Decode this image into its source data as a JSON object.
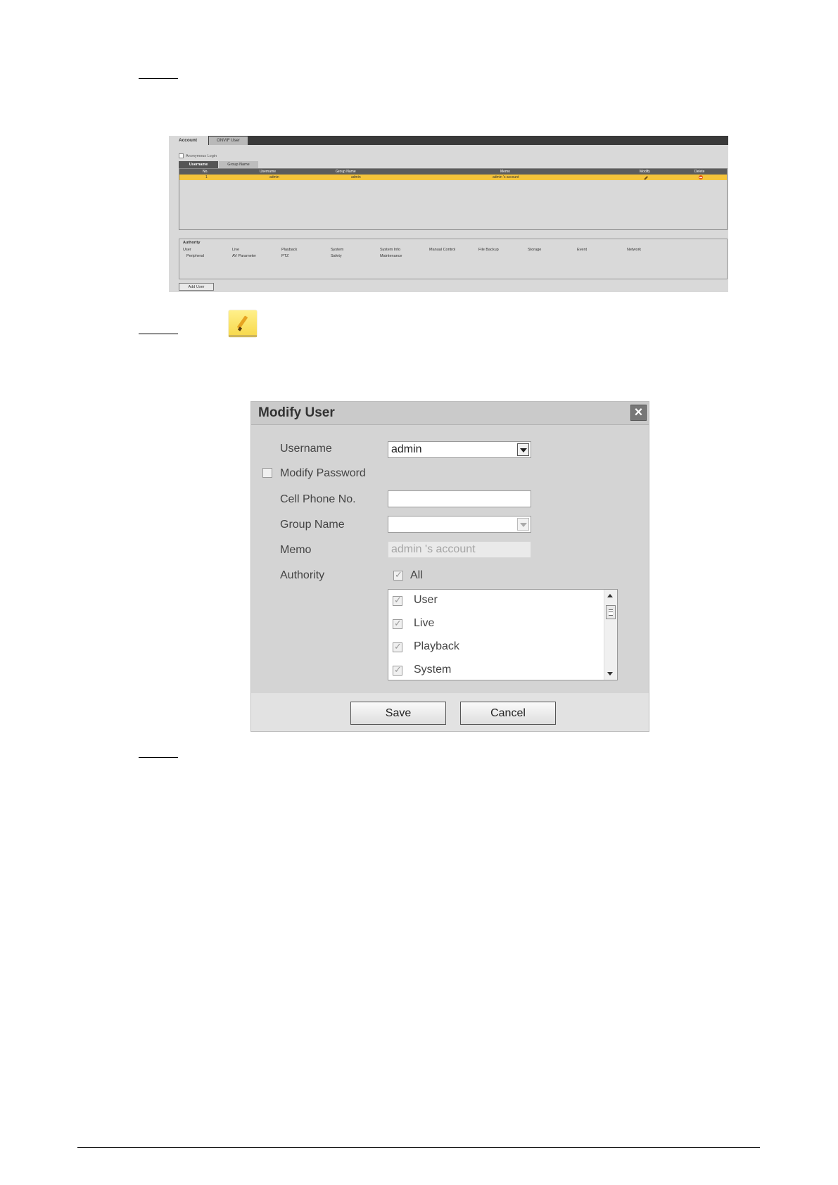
{
  "account_screen": {
    "tabs": [
      "Account",
      "ONVIF User"
    ],
    "anonymous_login": "Anonymous Login",
    "subtabs": [
      "Username",
      "Group Name"
    ],
    "table_headers": [
      "No.",
      "Username",
      "Group Name",
      "Memo",
      "Modify",
      "Delete"
    ],
    "rows": [
      {
        "no": "1",
        "username": "admin",
        "group_name": "admin",
        "memo": "admin 's account"
      }
    ],
    "authority_title": "Authority",
    "authority_items": [
      "User",
      "Live",
      "Playback",
      "System",
      "System Info",
      "Manual Control",
      "File Backup",
      "Storage",
      "Event",
      "Network",
      "Peripheral",
      "AV Parameter",
      "PTZ",
      "Safety",
      "Maintenance"
    ],
    "add_user": "Add User"
  },
  "modify_dialog": {
    "title": "Modify User",
    "username_label": "Username",
    "username_value": "admin",
    "modify_password_label": "Modify Password",
    "modify_password_checked": false,
    "cell_phone_label": "Cell Phone No.",
    "cell_phone_value": "",
    "group_name_label": "Group Name",
    "group_name_value": "",
    "memo_label": "Memo",
    "memo_value": "admin 's account",
    "authority_label": "Authority",
    "all_label": "All",
    "all_checked": true,
    "authority_list": [
      {
        "label": "User",
        "checked": true
      },
      {
        "label": "Live",
        "checked": true
      },
      {
        "label": "Playback",
        "checked": true
      },
      {
        "label": "System",
        "checked": true
      }
    ],
    "save_label": "Save",
    "cancel_label": "Cancel"
  }
}
